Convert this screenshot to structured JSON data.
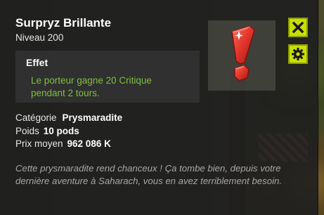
{
  "item": {
    "name": "Surpryz Brillante",
    "level_label": "Niveau",
    "level_value": "200"
  },
  "effect": {
    "title": "Effet",
    "lines": [
      "Le porteur gagne 20 Critique",
      "pendant 2 tours."
    ]
  },
  "stats": {
    "category_label": "Catégorie",
    "category_value": "Prysmaradite",
    "weight_label": "Poids",
    "weight_value": "10 pods",
    "price_label": "Prix moyen",
    "price_value": "962 086 K"
  },
  "description": "Cette prysmaradite rend chanceux ! Ça tombe bien, depuis votre dernière aventure à Saharach, vous en avez terriblement besoin.",
  "buttons": {
    "close_icon": "close-icon",
    "settings_icon": "gear-icon"
  },
  "colors": {
    "accent_button": "#c8e000",
    "effect_text": "#7fbf3f",
    "item_red": "#e0332b"
  }
}
